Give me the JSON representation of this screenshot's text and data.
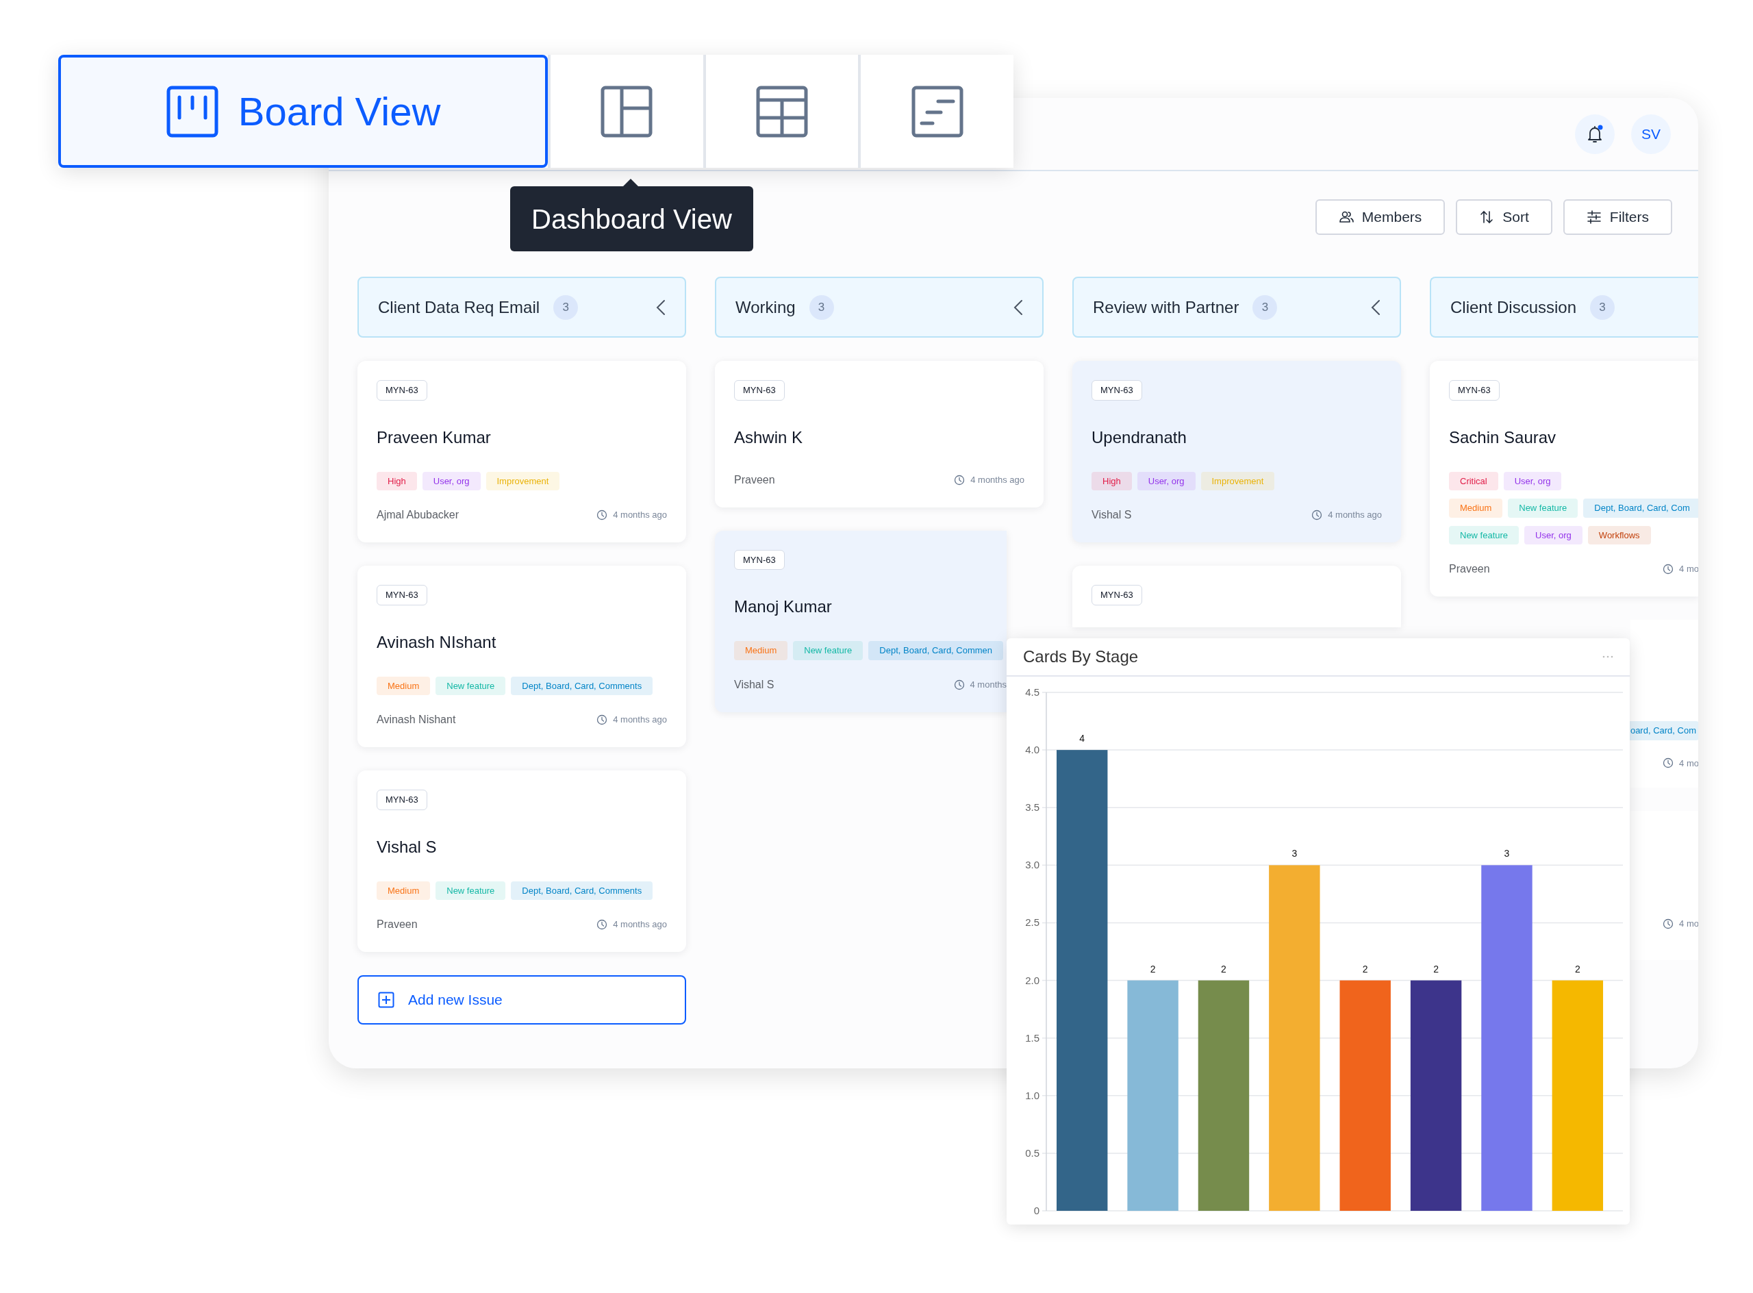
{
  "view_switcher": {
    "tabs": [
      {
        "kind": "board",
        "label": "Board View",
        "selected": true
      },
      {
        "kind": "dashboard",
        "selected": false
      },
      {
        "kind": "table",
        "selected": false
      },
      {
        "kind": "timeline",
        "selected": false
      }
    ],
    "tooltip": "Dashboard View"
  },
  "header": {
    "avatar": "SV",
    "notification": true
  },
  "toolbar": {
    "buttons": [
      {
        "kind": "members",
        "label": "Members"
      },
      {
        "kind": "sort",
        "label": "Sort"
      },
      {
        "kind": "filters",
        "label": "Filters"
      }
    ]
  },
  "columns": [
    {
      "title": "Client Data Req Email",
      "count": "3",
      "collapsible": true,
      "add_button": "Add new Issue",
      "cards": [
        {
          "id": "MYN-63",
          "title": "Praveen Kumar",
          "highlighted": false,
          "tag_rows": [
            [
              {
                "label": "High",
                "color": "#e11d48"
              },
              {
                "label": "User, org",
                "color": "#9333ea"
              },
              {
                "label": "Improvement",
                "color": "#eab308"
              }
            ]
          ],
          "assignee": "Ajmal Abubacker",
          "time": "4 months ago"
        },
        {
          "id": "MYN-63",
          "title": "Avinash NIshant",
          "highlighted": false,
          "tag_rows": [
            [
              {
                "label": "Medium",
                "color": "#f97316"
              },
              {
                "label": "New feature",
                "color": "#14b8a6"
              },
              {
                "label": "Dept, Board, Card, Comments",
                "color": "#0284c7"
              }
            ]
          ],
          "assignee": "Avinash Nishant",
          "time": "4 months ago"
        },
        {
          "id": "MYN-63",
          "title": "Vishal S",
          "highlighted": false,
          "tag_rows": [
            [
              {
                "label": "Medium",
                "color": "#f97316"
              },
              {
                "label": "New feature",
                "color": "#14b8a6"
              },
              {
                "label": "Dept, Board, Card, Comments",
                "color": "#0284c7"
              }
            ]
          ],
          "assignee": "Praveen",
          "time": "4 months ago"
        }
      ]
    },
    {
      "title": "Working",
      "count": "3",
      "collapsible": true,
      "cards": [
        {
          "id": "MYN-63",
          "title": "Ashwin K",
          "highlighted": false,
          "assignee": "Praveen",
          "time": "4 months ago"
        },
        {
          "id": "MYN-63",
          "title": "Manoj Kumar",
          "highlighted": true,
          "tag_rows": [
            [
              {
                "label": "Medium",
                "color": "#f97316"
              },
              {
                "label": "New feature",
                "color": "#14b8a6"
              },
              {
                "label": "Dept, Board, Card, Commen",
                "color": "#0284c7"
              }
            ]
          ],
          "assignee": "Vishal S",
          "time": "4 months"
        }
      ]
    },
    {
      "title": "Review with Partner",
      "count": "3",
      "collapsible": true,
      "cards": [
        {
          "id": "MYN-63",
          "title": "Upendranath",
          "highlighted": true,
          "tag_rows": [
            [
              {
                "label": "High",
                "color": "#e11d48"
              },
              {
                "label": "User, org",
                "color": "#9333ea"
              },
              {
                "label": "Improvement",
                "color": "#eab308"
              }
            ]
          ],
          "assignee": "Vishal S",
          "time": "4 months ago"
        },
        {
          "id": "MYN-63",
          "highlighted": false
        }
      ]
    },
    {
      "title": "Client Discussion",
      "count": "3",
      "collapsible": false,
      "cards": [
        {
          "id": "MYN-63",
          "title": "Sachin Saurav",
          "highlighted": false,
          "tag_rows": [
            [
              {
                "label": "Critical",
                "color": "#e11d48"
              },
              {
                "label": "User, org",
                "color": "#9333ea"
              }
            ],
            [
              {
                "label": "Medium",
                "color": "#f97316"
              },
              {
                "label": "New feature",
                "color": "#14b8a6"
              },
              {
                "label": "Dept, Board, Card, Com",
                "color": "#0284c7"
              }
            ],
            [
              {
                "label": "New feature",
                "color": "#14b8a6"
              },
              {
                "label": "User, org",
                "color": "#9333ea"
              },
              {
                "label": "Workflows",
                "color": "#c2410c"
              }
            ]
          ],
          "assignee": "Praveen",
          "time": "4 mo"
        },
        {
          "highlighted": false,
          "tag_rows": [
            [
              {
                "label": "oard, Card, Com",
                "color": "#0284c7"
              }
            ]
          ],
          "time": "4 mo"
        },
        {
          "highlighted": false,
          "time": "4 mo"
        }
      ]
    }
  ],
  "chart_panel": {
    "title": "Cards By Stage",
    "chart_data": {
      "type": "bar",
      "values": [
        4,
        2,
        2,
        3,
        2,
        2,
        3,
        2
      ],
      "colors": [
        "#336589",
        "#86b9d7",
        "#768c4c",
        "#f3ae30",
        "#f0641c",
        "#3d348b",
        "#7678ec",
        "#f5b800"
      ],
      "ylim": [
        0,
        4.5
      ],
      "yticks": [
        0,
        {
          "value": 0.5,
          "label": "0.5"
        },
        {
          "value": 1,
          "label": "1.0"
        },
        {
          "value": 1.5,
          "label": "1.5"
        },
        {
          "value": 2,
          "label": "2.0"
        },
        {
          "value": 2.5,
          "label": "2.5"
        },
        {
          "value": 3,
          "label": "3.0"
        },
        {
          "value": 3.5,
          "label": "3.5"
        },
        {
          "value": 4,
          "label": "4.0"
        },
        {
          "value": 4.5,
          "label": "4.5"
        }
      ],
      "data_labels": true,
      "grid": true
    }
  }
}
